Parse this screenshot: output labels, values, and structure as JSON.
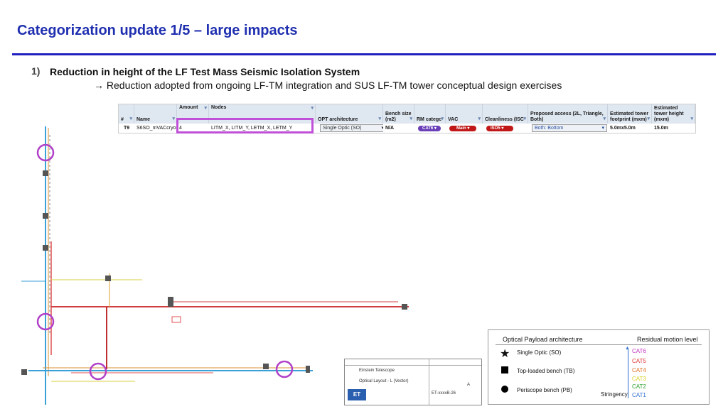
{
  "slide": {
    "title": "Categorization update 1/5 – large impacts",
    "item_number": "1)",
    "item_heading": "Reduction in height of the LF Test Mass Seismic Isolation System",
    "item_subtext": "→ Reduction adopted from ongoing LF-TM integration and SUS LF-TM tower conceptual design exercises"
  },
  "table": {
    "headers": {
      "num": "#",
      "name": "Name",
      "amount": "Amount",
      "nodes": "Nodes",
      "opt": "OPT architecture",
      "bench": "Bench size (m2)",
      "rm": "RM categc",
      "vac": "VAC",
      "clean": "Cleanliness (ISC",
      "access": "Proposed access (2L, Triangle, Both)",
      "footprint": "Estimated tower footprint (mxm)",
      "height": "Estimated tower height (mxm)"
    },
    "row": {
      "num": "T9",
      "name": "S6SO_mVACcryo",
      "amount": "4",
      "nodes": "LITM_X, LITM_Y, LETM_X, LETM_Y",
      "opt": "Single Optic (SO)",
      "bench": "N/A",
      "rm": "CAT6",
      "vac": "Main",
      "clean": "ISO5",
      "access": "Both: Bottom",
      "footprint": "5.0mx5.0m",
      "height": "15.0m"
    },
    "colors": {
      "cat6": "#6a3fb8",
      "main": "#c01818",
      "iso5": "#c01818"
    }
  },
  "legend": {
    "header_left": "Optical Payload architecture",
    "header_right": "Residual motion level",
    "items": [
      "Single Optic (SO)",
      "Top-loaded bench (TB)",
      "Periscope bench (PB)"
    ],
    "stringency": "Stringency",
    "categories": [
      {
        "label": "CAT6",
        "color": "#c030c0"
      },
      {
        "label": "CAT5",
        "color": "#e03030"
      },
      {
        "label": "CAT4",
        "color": "#e07020"
      },
      {
        "label": "CAT3",
        "color": "#d8d020"
      },
      {
        "label": "CAT2",
        "color": "#30a030"
      },
      {
        "label": "CAT1",
        "color": "#3070d0"
      }
    ]
  },
  "title_block": {
    "project": "Einstein Telescope",
    "drawing": "Optical Layout - L (Vector)",
    "number": "ET-xxxxB-26",
    "rev": "A"
  }
}
